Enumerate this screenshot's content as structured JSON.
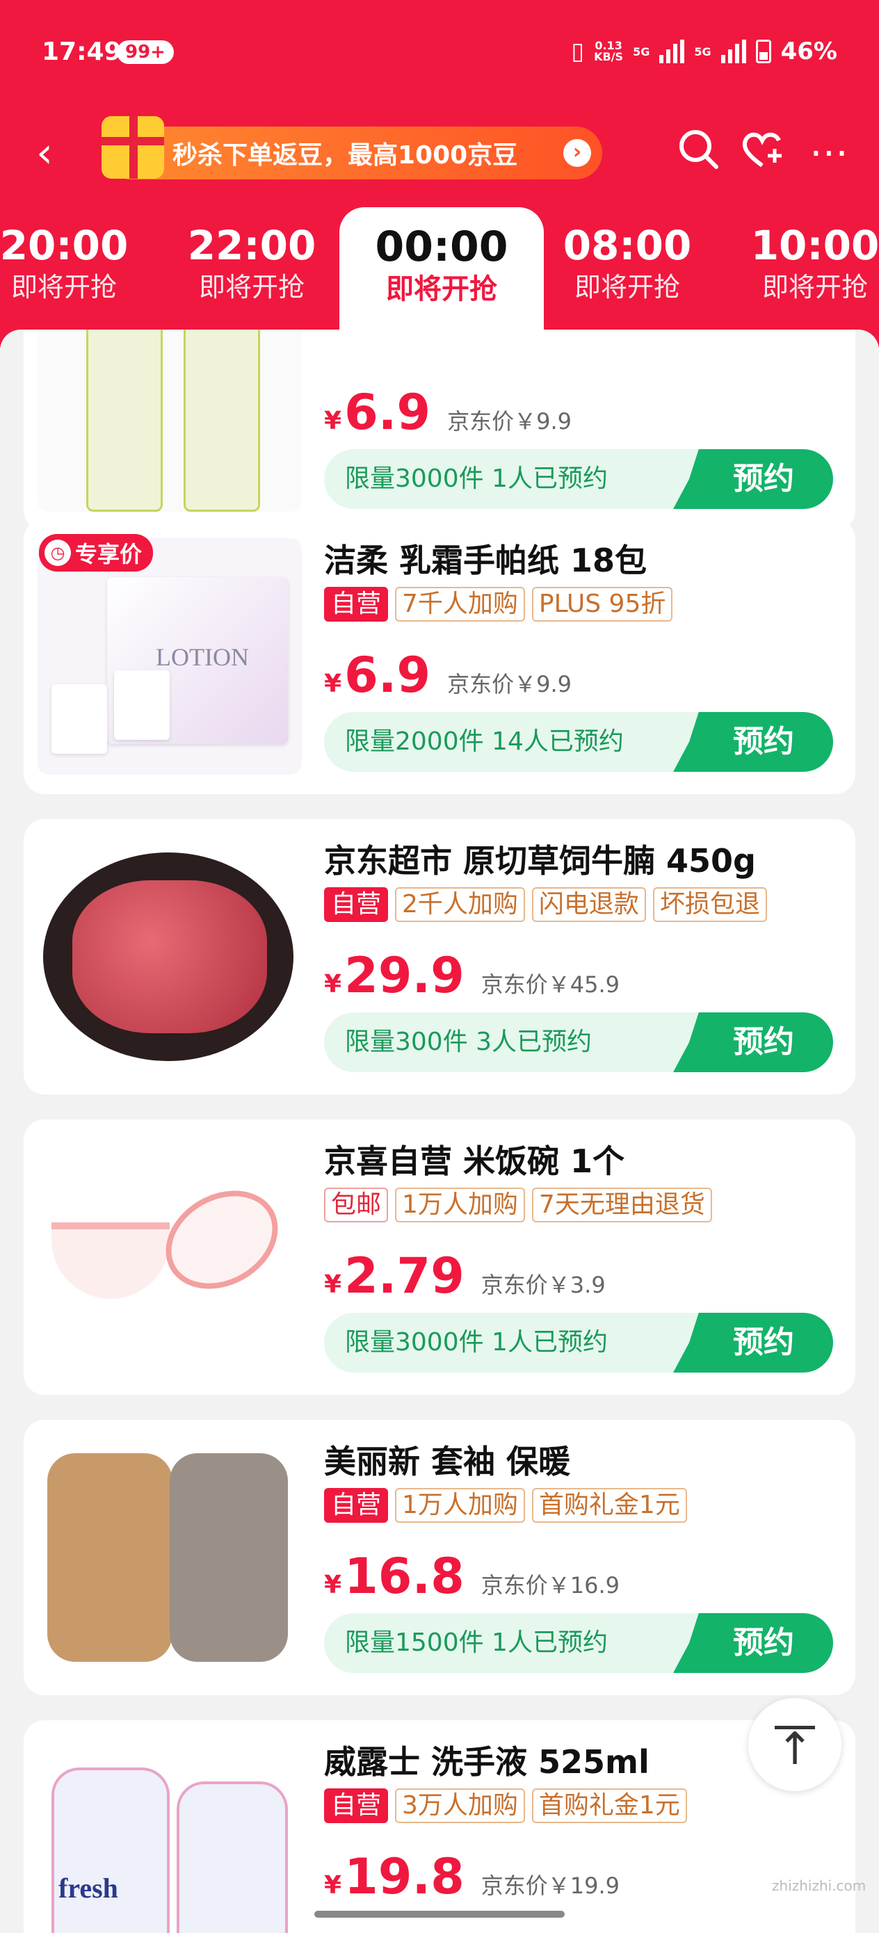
{
  "status": {
    "time": "17:49",
    "badge": "99+",
    "net_rate": "0.13",
    "net_unit": "KB/S",
    "sig1": "5G",
    "sig2": "5G",
    "battery": "46%"
  },
  "header": {
    "back_icon": "chevron-left-icon",
    "promo_text": "秒杀下单返豆，最高1000京豆",
    "icons": [
      "search-icon",
      "heart-plus-icon",
      "more-icon"
    ]
  },
  "tabs": [
    {
      "time": "20:00",
      "status": "即将开抢"
    },
    {
      "time": "22:00",
      "status": "即将开抢"
    },
    {
      "time": "00:00",
      "status": "即将开抢"
    },
    {
      "time": "08:00",
      "status": "即将开抢"
    },
    {
      "time": "10:00",
      "status": "即将开抢"
    }
  ],
  "products": [
    {
      "title": "",
      "price": "6.9",
      "jd_price": "京东价￥9.9",
      "quota": "限量3000件 1人已预约",
      "button": "预约"
    },
    {
      "badge": "专享价",
      "title": "洁柔 乳霜手帕纸 18包",
      "tags": [
        "自营",
        "7千人加购",
        "PLUS 95折"
      ],
      "price": "6.9",
      "jd_price": "京东价￥9.9",
      "quota": "限量2000件 14人已预约",
      "button": "预约"
    },
    {
      "title": "京东超市 原切草饲牛腩 450g",
      "tags": [
        "自营",
        "2千人加购",
        "闪电退款",
        "坏损包退"
      ],
      "price": "29.9",
      "jd_price": "京东价￥45.9",
      "quota": "限量300件 3人已预约",
      "button": "预约"
    },
    {
      "title": "京喜自营 米饭碗 1个",
      "tags": [
        "包邮",
        "1万人加购",
        "7天无理由退货"
      ],
      "price": "2.79",
      "jd_price": "京东价￥3.9",
      "quota": "限量3000件 1人已预约",
      "button": "预约"
    },
    {
      "title": "美丽新 套袖 保暖",
      "tags": [
        "自营",
        "1万人加购",
        "首购礼金1元"
      ],
      "price": "16.8",
      "jd_price": "京东价￥16.9",
      "quota": "限量1500件 1人已预约",
      "button": "预约"
    },
    {
      "title": "威露士 洗手液 525ml",
      "tags": [
        "自营",
        "3万人加购",
        "首购礼金1元"
      ],
      "price": "19.8",
      "jd_price": "京东价￥19.9"
    }
  ],
  "yen": "¥",
  "lotion_text": "LOTION",
  "fresh_text": "fresh",
  "watermark": "zhizhizhi.com",
  "colors": {
    "brand": "#f0183f",
    "green": "#13b36a"
  }
}
